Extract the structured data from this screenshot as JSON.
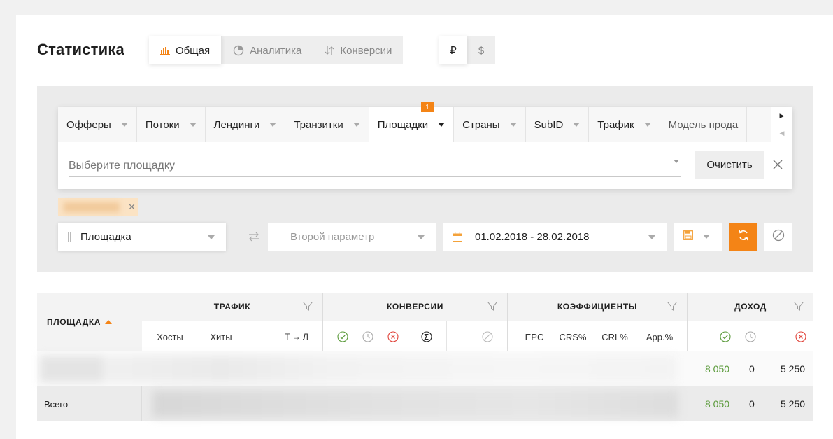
{
  "page": {
    "title": "Статистика"
  },
  "view_tabs": [
    {
      "label": "Общая",
      "icon": "bar-chart-icon",
      "active": true
    },
    {
      "label": "Аналитика",
      "icon": "pie-chart-icon",
      "active": false
    },
    {
      "label": "Конверсии",
      "icon": "sort-arrows-icon",
      "active": false
    }
  ],
  "currency_tabs": [
    {
      "label": "₽",
      "active": true
    },
    {
      "label": "$",
      "active": false
    }
  ],
  "filters": {
    "tabs": [
      {
        "label": "Офферы"
      },
      {
        "label": "Потоки"
      },
      {
        "label": "Лендинги"
      },
      {
        "label": "Транзитки"
      },
      {
        "label": "Площадки",
        "active": true,
        "badge": "1"
      },
      {
        "label": "Страны"
      },
      {
        "label": "SubID"
      },
      {
        "label": "Трафик"
      },
      {
        "label": "Модель прода"
      }
    ],
    "select_placeholder": "Выберите площадку",
    "clear_label": "Очистить"
  },
  "controls": {
    "group_by": "Площадка",
    "second_param_placeholder": "Второй параметр",
    "date_range": "01.02.2018 - 28.02.2018"
  },
  "table": {
    "first_col": "ПЛОЩАДКА",
    "groups": {
      "traffic": "ТРАФИК",
      "conversions": "КОНВЕРСИИ",
      "ratios": "КОЭФФИЦИЕНТЫ",
      "income": "ДОХОД"
    },
    "sub": {
      "hosts": "Хосты",
      "hits": "Хиты",
      "tl": "Т → Л",
      "epc": "EPC",
      "crs": "CRS%",
      "crl": "CRL%",
      "app": "App.%"
    },
    "rows": [
      {
        "label": "",
        "income_approved": "8 050",
        "income_pending": "0",
        "income_rejected": "5 250"
      },
      {
        "label": "Всего",
        "income_approved": "8 050",
        "income_pending": "0",
        "income_rejected": "5 250"
      }
    ]
  },
  "colors": {
    "accent": "#f48416",
    "green": "#5a9a3a",
    "red": "#e0433a"
  }
}
